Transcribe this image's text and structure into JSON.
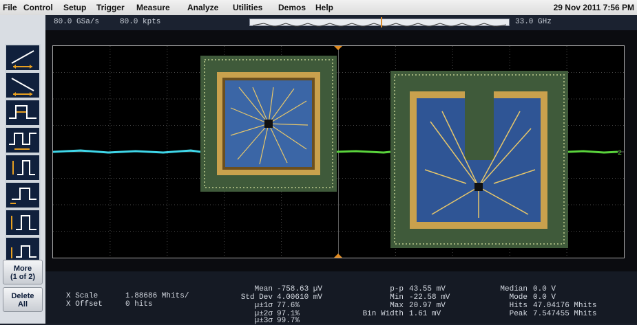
{
  "menu": {
    "items": [
      "File",
      "Control",
      "Setup",
      "Trigger",
      "Measure",
      "Analyze",
      "Utilities",
      "Demos",
      "Help"
    ],
    "datetime": "29 Nov 2011  7:56 PM"
  },
  "info": {
    "sample_rate": "80.0 GSa/s",
    "memory_depth": "80.0 kpts",
    "bandwidth": "33.0 GHz"
  },
  "toolbar": {
    "tools": [
      "rising-edge-icon",
      "falling-edge-icon",
      "positive-pulse-width-icon",
      "pulse-period-icon",
      "pulse-width-marker-icon",
      "pulse-amplitude-icon",
      "pulse-top-icon",
      "pulse-base-icon"
    ],
    "more_label": "More\n(1 of 2)",
    "more_line1": "More",
    "more_line2": "(1 of 2)",
    "delete_line1": "Delete",
    "delete_line2": "All"
  },
  "waveform": {
    "channel_label": "2",
    "colors": {
      "trace_left": "#3fd6e8",
      "trace_right": "#5ad33c",
      "grid": "#4a4a4a",
      "chip_substrate": "#3f5a3a",
      "chip_gold": "#c9a14d",
      "chip_die": "#3b66a6"
    }
  },
  "measurements": {
    "x_scale_label": "X Scale",
    "x_scale_value": "1.88686 Mhits/",
    "x_offset_label": "X Offset",
    "x_offset_value": "0 hits",
    "mean_label": "Mean",
    "mean_value": "-758.63 µV",
    "std_dev_label": "Std Dev",
    "std_dev_value": "4.00610 mV",
    "sigma1_label": "µ±1σ",
    "sigma1_value": "77.6%",
    "sigma2_label": "µ±2σ",
    "sigma2_value": "97.1%",
    "sigma3_label": "µ±3σ",
    "sigma3_value": "99.7%",
    "pp_label": "p-p",
    "pp_value": "43.55 mV",
    "min_label": "Min",
    "min_value": "-22.58 mV",
    "max_label": "Max",
    "max_value": "20.97 mV",
    "bin_width_label": "Bin Width",
    "bin_width_value": "1.61 mV",
    "median_label": "Median",
    "median_value": "0.0 V",
    "mode_label": "Mode",
    "mode_value": "0.0 V",
    "hits_label": "Hits",
    "hits_value": "47.04176 Mhits",
    "peak_label": "Peak",
    "peak_value": "7.547455 Mhits"
  }
}
